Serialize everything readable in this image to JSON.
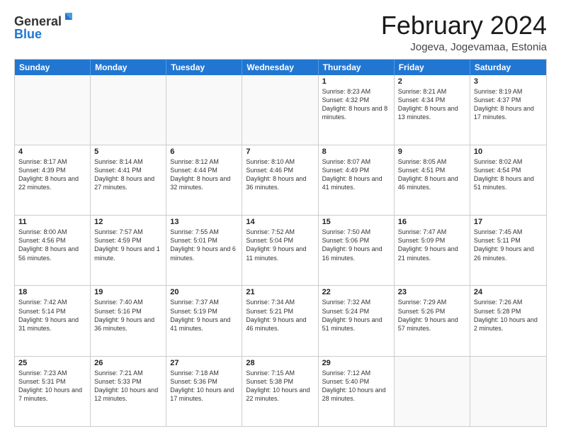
{
  "logo": {
    "general": "General",
    "blue": "Blue"
  },
  "title": "February 2024",
  "subtitle": "Jogeva, Jogevamaa, Estonia",
  "days_of_week": [
    "Sunday",
    "Monday",
    "Tuesday",
    "Wednesday",
    "Thursday",
    "Friday",
    "Saturday"
  ],
  "weeks": [
    [
      {
        "day": "",
        "empty": true
      },
      {
        "day": "",
        "empty": true
      },
      {
        "day": "",
        "empty": true
      },
      {
        "day": "",
        "empty": true
      },
      {
        "day": "1",
        "sunrise": "8:23 AM",
        "sunset": "4:32 PM",
        "daylight": "8 hours and 8 minutes."
      },
      {
        "day": "2",
        "sunrise": "8:21 AM",
        "sunset": "4:34 PM",
        "daylight": "8 hours and 13 minutes."
      },
      {
        "day": "3",
        "sunrise": "8:19 AM",
        "sunset": "4:37 PM",
        "daylight": "8 hours and 17 minutes."
      }
    ],
    [
      {
        "day": "4",
        "sunrise": "8:17 AM",
        "sunset": "4:39 PM",
        "daylight": "8 hours and 22 minutes."
      },
      {
        "day": "5",
        "sunrise": "8:14 AM",
        "sunset": "4:41 PM",
        "daylight": "8 hours and 27 minutes."
      },
      {
        "day": "6",
        "sunrise": "8:12 AM",
        "sunset": "4:44 PM",
        "daylight": "8 hours and 32 minutes."
      },
      {
        "day": "7",
        "sunrise": "8:10 AM",
        "sunset": "4:46 PM",
        "daylight": "8 hours and 36 minutes."
      },
      {
        "day": "8",
        "sunrise": "8:07 AM",
        "sunset": "4:49 PM",
        "daylight": "8 hours and 41 minutes."
      },
      {
        "day": "9",
        "sunrise": "8:05 AM",
        "sunset": "4:51 PM",
        "daylight": "8 hours and 46 minutes."
      },
      {
        "day": "10",
        "sunrise": "8:02 AM",
        "sunset": "4:54 PM",
        "daylight": "8 hours and 51 minutes."
      }
    ],
    [
      {
        "day": "11",
        "sunrise": "8:00 AM",
        "sunset": "4:56 PM",
        "daylight": "8 hours and 56 minutes."
      },
      {
        "day": "12",
        "sunrise": "7:57 AM",
        "sunset": "4:59 PM",
        "daylight": "9 hours and 1 minute."
      },
      {
        "day": "13",
        "sunrise": "7:55 AM",
        "sunset": "5:01 PM",
        "daylight": "9 hours and 6 minutes."
      },
      {
        "day": "14",
        "sunrise": "7:52 AM",
        "sunset": "5:04 PM",
        "daylight": "9 hours and 11 minutes."
      },
      {
        "day": "15",
        "sunrise": "7:50 AM",
        "sunset": "5:06 PM",
        "daylight": "9 hours and 16 minutes."
      },
      {
        "day": "16",
        "sunrise": "7:47 AM",
        "sunset": "5:09 PM",
        "daylight": "9 hours and 21 minutes."
      },
      {
        "day": "17",
        "sunrise": "7:45 AM",
        "sunset": "5:11 PM",
        "daylight": "9 hours and 26 minutes."
      }
    ],
    [
      {
        "day": "18",
        "sunrise": "7:42 AM",
        "sunset": "5:14 PM",
        "daylight": "9 hours and 31 minutes."
      },
      {
        "day": "19",
        "sunrise": "7:40 AM",
        "sunset": "5:16 PM",
        "daylight": "9 hours and 36 minutes."
      },
      {
        "day": "20",
        "sunrise": "7:37 AM",
        "sunset": "5:19 PM",
        "daylight": "9 hours and 41 minutes."
      },
      {
        "day": "21",
        "sunrise": "7:34 AM",
        "sunset": "5:21 PM",
        "daylight": "9 hours and 46 minutes."
      },
      {
        "day": "22",
        "sunrise": "7:32 AM",
        "sunset": "5:24 PM",
        "daylight": "9 hours and 51 minutes."
      },
      {
        "day": "23",
        "sunrise": "7:29 AM",
        "sunset": "5:26 PM",
        "daylight": "9 hours and 57 minutes."
      },
      {
        "day": "24",
        "sunrise": "7:26 AM",
        "sunset": "5:28 PM",
        "daylight": "10 hours and 2 minutes."
      }
    ],
    [
      {
        "day": "25",
        "sunrise": "7:23 AM",
        "sunset": "5:31 PM",
        "daylight": "10 hours and 7 minutes."
      },
      {
        "day": "26",
        "sunrise": "7:21 AM",
        "sunset": "5:33 PM",
        "daylight": "10 hours and 12 minutes."
      },
      {
        "day": "27",
        "sunrise": "7:18 AM",
        "sunset": "5:36 PM",
        "daylight": "10 hours and 17 minutes."
      },
      {
        "day": "28",
        "sunrise": "7:15 AM",
        "sunset": "5:38 PM",
        "daylight": "10 hours and 22 minutes."
      },
      {
        "day": "29",
        "sunrise": "7:12 AM",
        "sunset": "5:40 PM",
        "daylight": "10 hours and 28 minutes."
      },
      {
        "day": "",
        "empty": true
      },
      {
        "day": "",
        "empty": true
      }
    ]
  ]
}
